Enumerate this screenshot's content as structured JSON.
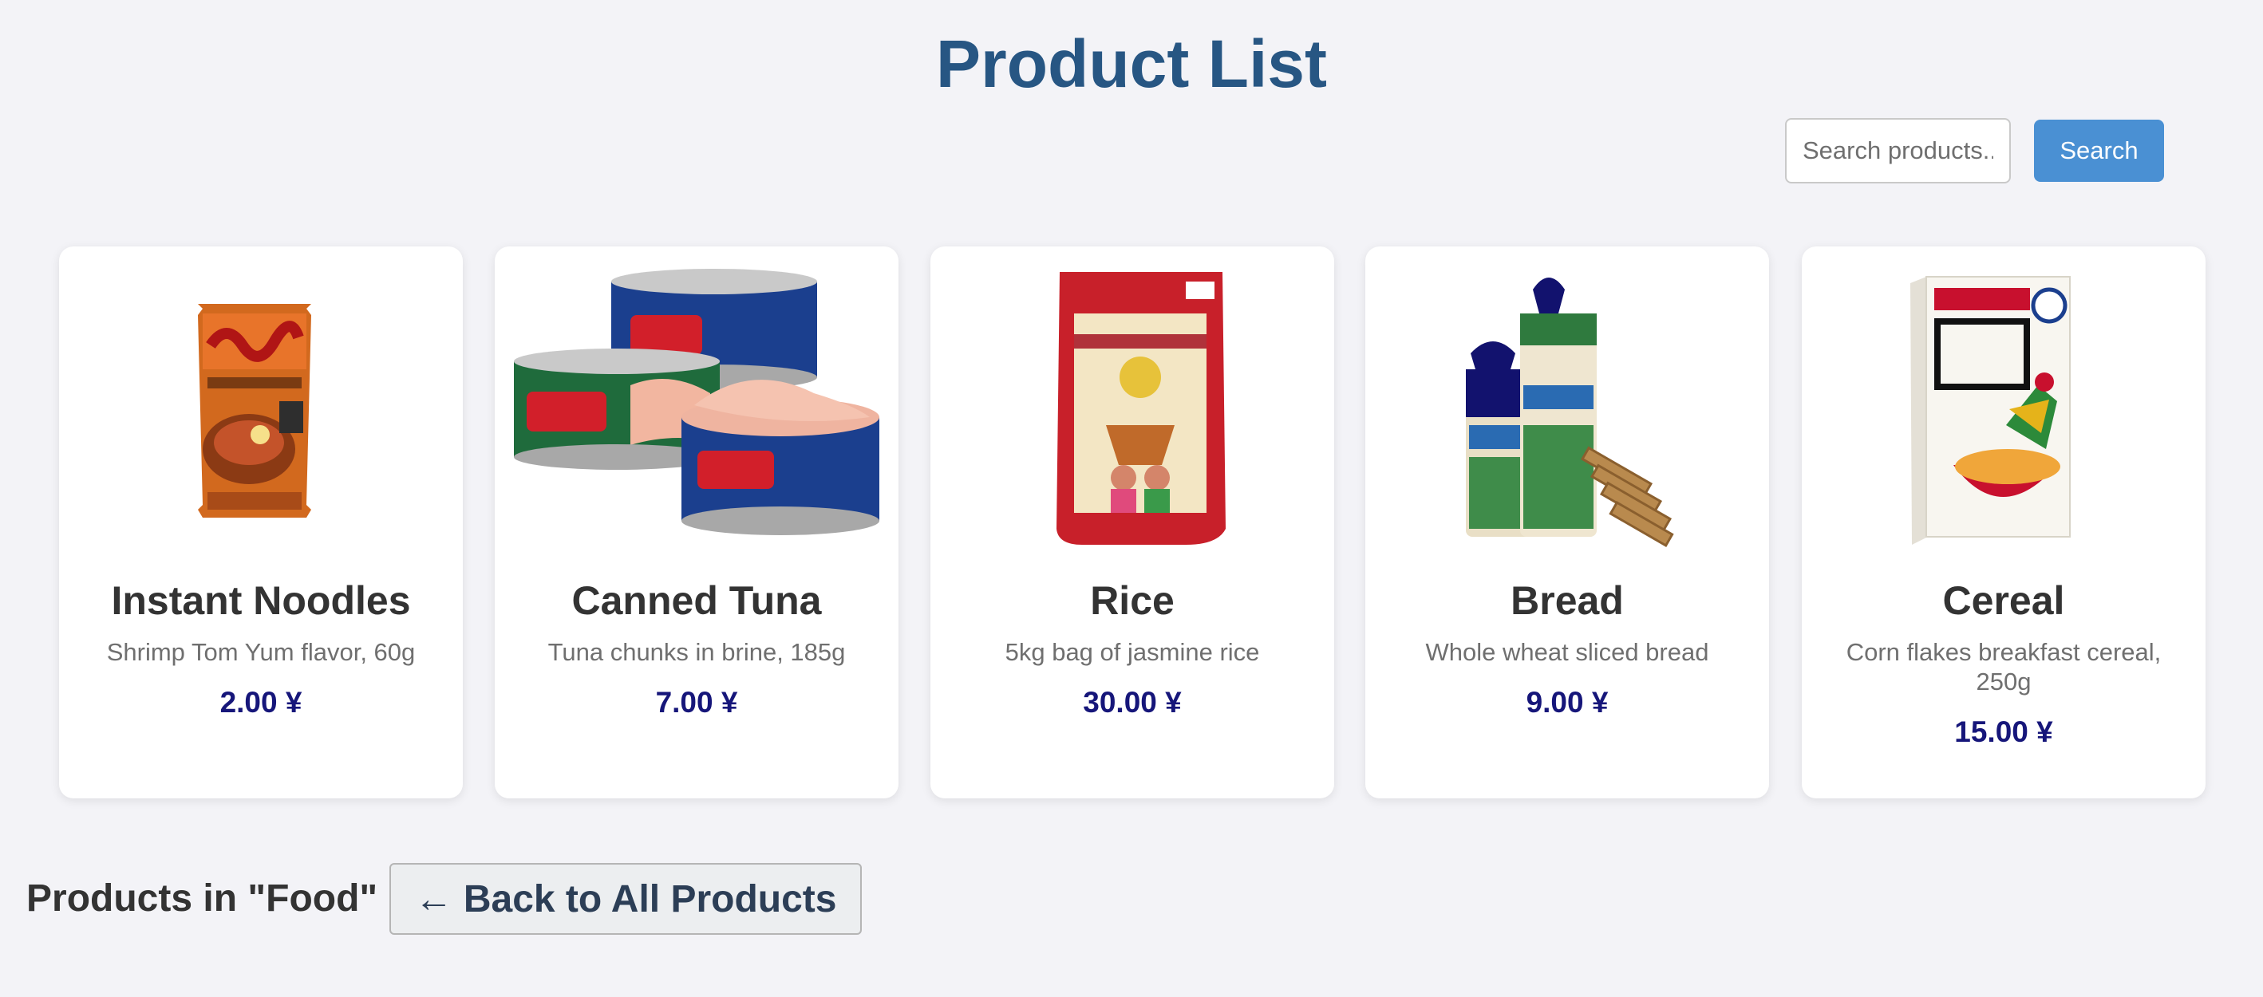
{
  "page_title": "Product List",
  "search": {
    "placeholder": "Search products...",
    "value": "",
    "button_label": "Search"
  },
  "products": [
    {
      "name": "Instant Noodles",
      "description": "Shrimp Tom Yum flavor, 60g",
      "price": "2.00 ¥",
      "image_icon": "instant-noodles-package"
    },
    {
      "name": "Canned Tuna",
      "description": "Tuna chunks in brine, 185g",
      "price": "7.00 ¥",
      "image_icon": "canned-tuna-tins"
    },
    {
      "name": "Rice",
      "description": "5kg bag of jasmine rice",
      "price": "30.00 ¥",
      "image_icon": "jasmine-rice-bag"
    },
    {
      "name": "Bread",
      "description": "Whole wheat sliced bread",
      "price": "9.00 ¥",
      "image_icon": "sliced-bread-loaves"
    },
    {
      "name": "Cereal",
      "description": "Corn flakes breakfast cereal, 250g",
      "price": "15.00 ¥",
      "image_icon": "corn-flakes-box"
    }
  ],
  "category": {
    "heading": "Products in \"Food\"",
    "back_label": "← Back to All Products"
  },
  "colors": {
    "background": "#f3f3f7",
    "title": "#275683",
    "search_button": "#4a90d3",
    "price": "#16167a",
    "text": "#333333",
    "muted": "#6f6f6f"
  }
}
